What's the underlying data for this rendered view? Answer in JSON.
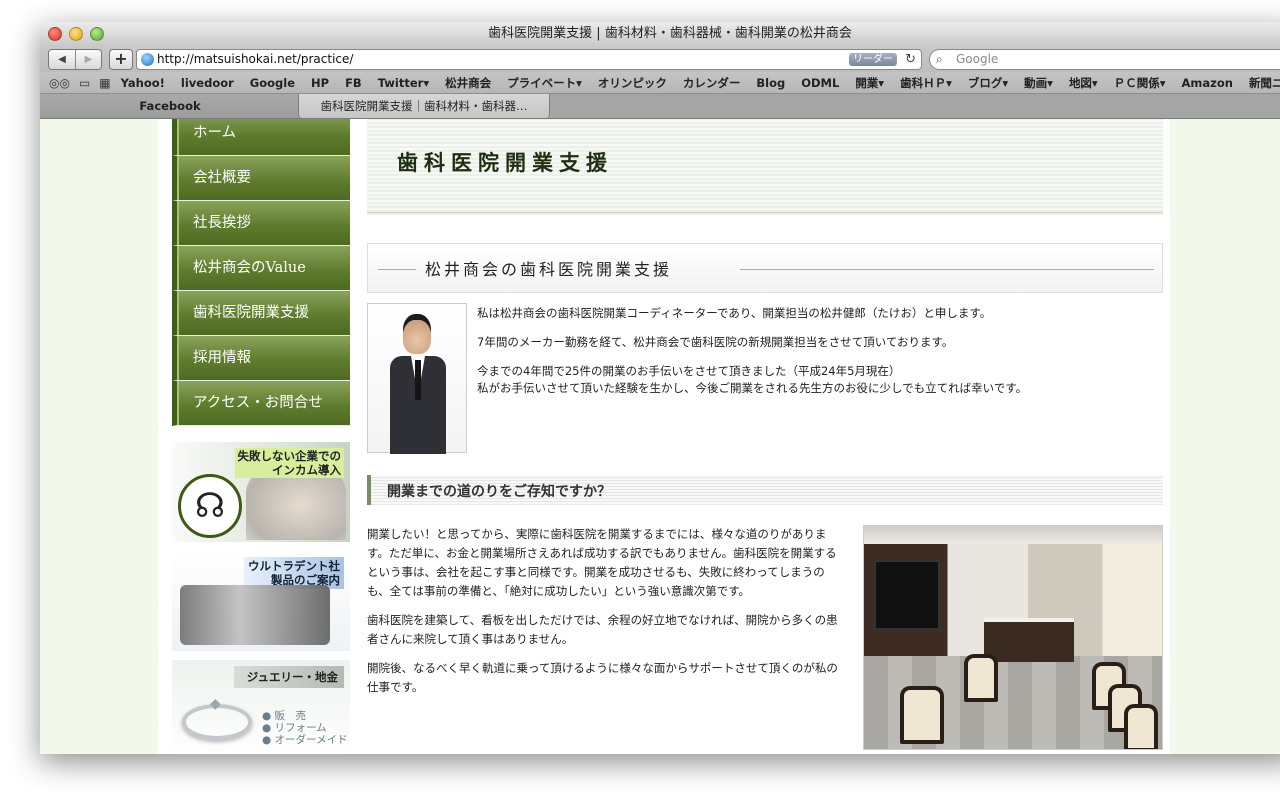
{
  "window": {
    "title": "歯科医院開業支援 | 歯科材料・歯科器械・歯科開業の松井商会"
  },
  "toolbar": {
    "back_label": "◀",
    "forward_label": "▶",
    "add_label": "+",
    "url": "http://matsuishokai.net/practice/",
    "reader_label": "リーダー",
    "reload_label": "↻",
    "search_placeholder": "Google"
  },
  "bookmarks": [
    "Yahoo!",
    "livedoor",
    "Google",
    "HP",
    "FB",
    "Twitter▾",
    "松井商会",
    "プライベート▾",
    "オリンピック",
    "カレンダー",
    "Blog",
    "ODML",
    "開業▾",
    "歯科ＨＰ▾",
    "ブログ▾",
    "動画▾",
    "地図▾",
    "ＰＣ関係▾",
    "Amazon",
    "新聞ニュース▾"
  ],
  "tabs": [
    {
      "label": "Facebook"
    },
    {
      "label": "歯科医院開業支援｜歯科材料・歯科器…"
    }
  ],
  "sidebar": {
    "items": [
      {
        "label": "ホーム"
      },
      {
        "label": "会社概要"
      },
      {
        "label": "社長挨拶"
      },
      {
        "label": "松井商会のValue"
      },
      {
        "label": "歯科医院開業支援"
      },
      {
        "label": "採用情報"
      },
      {
        "label": "アクセス・お問合せ"
      }
    ],
    "banners": {
      "incom": {
        "line1": "失敗しない企業での",
        "line2": "インカム導入"
      },
      "ultradent": {
        "line1": "ウルトラデント社",
        "line2": "製品のご案内"
      },
      "jewelry": {
        "title": "ジュエリー・地金",
        "items": [
          "● 販　売",
          "● リフォーム",
          "● オーダーメイド"
        ]
      }
    }
  },
  "main": {
    "page_title": "歯科医院開業支援",
    "section_title": "松井商会の歯科医院開業支援",
    "intro": [
      "私は松井商会の歯科医院開業コーディネーターであり、開業担当の松井健郎（たけお）と申します。",
      "7年間のメーカー勤務を経て、松井商会で歯科医院の新規開業担当をさせて頂いております。",
      "今までの4年間で25件の開業のお手伝いをさせて頂きました（平成24年5月現在）",
      "私がお手伝いさせて頂いた経験を生かし、今後ご開業をされる先生方のお役に少しでも立てれば幸いです。"
    ],
    "road_title": "開業までの道のりをご存知ですか？",
    "paragraphs": [
      "開業したい！と思ってから、実際に歯科医院を開業するまでには、様々な道のりがあります。ただ単に、お金と開業場所さえあれば成功する訳でもありません。歯科医院を開業するという事は、会社を起こす事と同様です。開業を成功させるも、失敗に終わってしまうのも、全ては事前の準備と、「絶対に成功したい」という強い意識次第です。",
      "歯科医院を建築して、看板を出しただけでは、余程の好立地でなければ、開院から多くの患者さんに来院して頂く事はありません。",
      "開院後、なるべく早く軌道に乗って頂けるように様々な面からサポートさせて頂くのが私の仕事です。"
    ]
  }
}
